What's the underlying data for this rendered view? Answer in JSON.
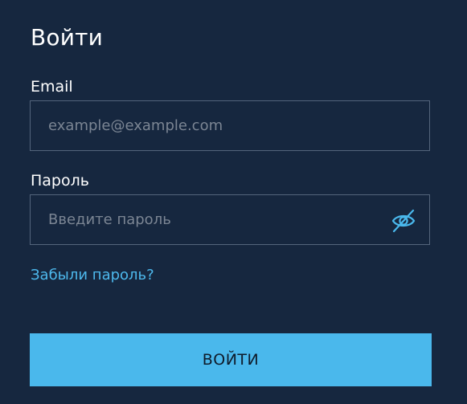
{
  "login": {
    "title": "Войти",
    "email_label": "Email",
    "email_placeholder": "example@example.com",
    "password_label": "Пароль",
    "password_placeholder": "Введите пароль",
    "forgot_link": "Забыли пароль?",
    "submit_label": "ВОЙТИ"
  },
  "icons": {
    "password_toggle": "eye-slash-icon"
  },
  "colors": {
    "background": "#16273f",
    "accent": "#4ab8ec",
    "field_border": "#54657c",
    "placeholder": "#7b8593"
  }
}
